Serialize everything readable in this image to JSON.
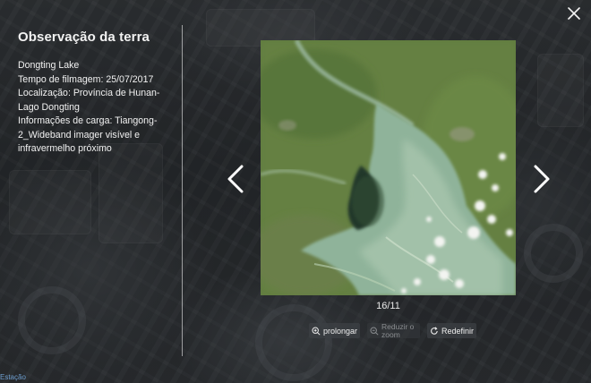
{
  "dialog": {
    "title": "Observação da terra",
    "close_label": "×"
  },
  "info": {
    "lines": [
      "Dongting Lake",
      "Tempo de filmagem: 25/07/2017",
      "Localização: Província de Hunan-Lago Dongting",
      "Informações de carga: Tiangong-2_Wideband imager visível e infravermelho próximo"
    ]
  },
  "viewer": {
    "counter": "16/11",
    "image_subject": "Dongting Lake satellite image"
  },
  "toolbar": {
    "extend_label": "prolongar",
    "zoom_out_label": "Reduzir o zoom",
    "reset_label": "Redefinir"
  },
  "corner": {
    "label": "Estação"
  },
  "icons": {
    "close": "close-icon",
    "prev": "chevron-left-icon",
    "next": "chevron-right-icon",
    "zoom_in": "zoom-in-icon",
    "zoom_out": "zoom-out-icon",
    "reset": "reset-icon"
  },
  "colors": {
    "text": "#f2f2f2",
    "land": "#5e7a3d",
    "lake": "#8fb59a",
    "corner_label": "#6f9fcf"
  }
}
